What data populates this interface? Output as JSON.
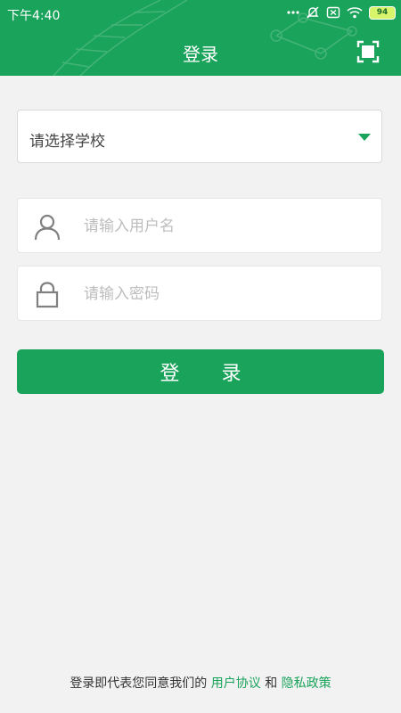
{
  "status_bar": {
    "time": "下午4:40",
    "battery": "94",
    "icons": [
      "dots-icon",
      "mute-alarm-icon",
      "sim-off-icon",
      "wifi-icon",
      "battery-icon"
    ]
  },
  "header": {
    "title": "登录",
    "scan_icon": "scan-icon"
  },
  "form": {
    "school_select": {
      "value": "请选择学校"
    },
    "username": {
      "placeholder": "请输入用户名",
      "value": "",
      "icon": "user-icon"
    },
    "password": {
      "placeholder": "请输入密码",
      "value": "",
      "icon": "lock-icon"
    },
    "login_button": "登 录"
  },
  "footer": {
    "prefix": "登录即代表您同意我们的",
    "user_agreement": "用户协议",
    "and": "和",
    "privacy_policy": "隐私政策"
  },
  "colors": {
    "brand": "#1aa35a",
    "background": "#f2f2f2"
  }
}
